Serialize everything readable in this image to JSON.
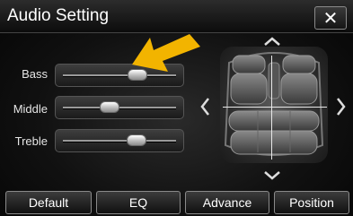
{
  "window": {
    "title": "Audio Setting",
    "close_label": "✕"
  },
  "sliders": [
    {
      "label": "Bass",
      "value": 0.66
    },
    {
      "label": "Middle",
      "value": 0.41
    },
    {
      "label": "Treble",
      "value": 0.65
    }
  ],
  "balance": {
    "icons": [
      "up-arrow-icon",
      "down-arrow-icon",
      "left-arrow-icon",
      "right-arrow-icon"
    ]
  },
  "buttons": {
    "default": "Default",
    "eq": "EQ",
    "advance": "Advance",
    "position": "Position"
  },
  "colors": {
    "annotation_arrow": "#f2b400"
  }
}
